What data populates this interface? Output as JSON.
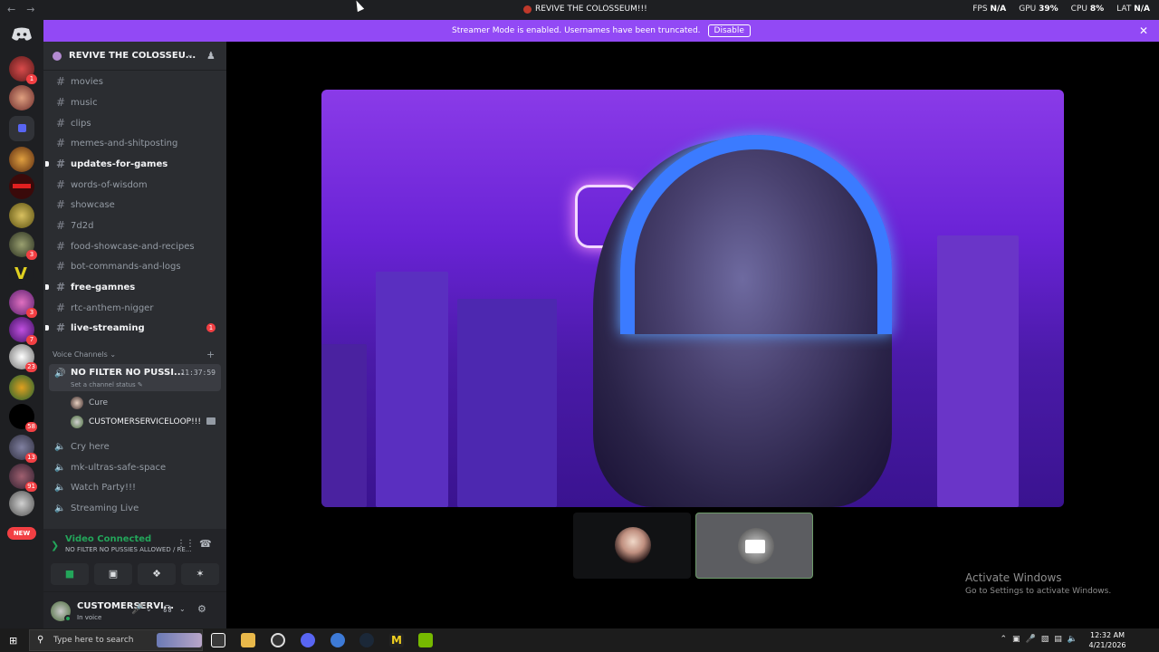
{
  "window": {
    "title": "REVIVE THE COLOSSEUM!!!",
    "stats": [
      {
        "label": "FPS",
        "value": "N/A"
      },
      {
        "label": "GPU",
        "value": "39%"
      },
      {
        "label": "CPU",
        "value": "8%"
      },
      {
        "label": "LAT",
        "value": "N/A"
      }
    ]
  },
  "banner": {
    "text": "Streamer Mode is enabled. Usernames have been truncated.",
    "button": "Disable"
  },
  "rail": {
    "badges": [
      "1",
      "3",
      "3",
      "7",
      "23",
      "58",
      "13",
      "91"
    ],
    "new_label": "NEW"
  },
  "server": {
    "name": "REVIVE THE COLOSSEU..."
  },
  "channels": [
    {
      "name": "movies",
      "unread": false
    },
    {
      "name": "music",
      "unread": false
    },
    {
      "name": "clips",
      "unread": false
    },
    {
      "name": "memes-and-shitposting",
      "unread": false
    },
    {
      "name": "updates-for-games",
      "unread": true
    },
    {
      "name": "words-of-wisdom",
      "unread": false
    },
    {
      "name": "showcase",
      "unread": false
    },
    {
      "name": "7d2d",
      "unread": false
    },
    {
      "name": "food-showcase-and-recipes",
      "unread": false
    },
    {
      "name": "bot-commands-and-logs",
      "unread": false
    },
    {
      "name": "free-gamnes",
      "unread": true
    },
    {
      "name": "rtc-anthem-nigger",
      "unread": false
    },
    {
      "name": "live-streaming",
      "unread": true,
      "mentions": "1"
    }
  ],
  "voice": {
    "category": "Voice Channels",
    "active_channel": {
      "name": "NO FILTER NO PUSSI...",
      "timer": "11:37:59",
      "status": "Set a channel status"
    },
    "users": [
      "Cure",
      "CUSTOMERSERVICELOOP!!!"
    ],
    "other_channels": [
      "Cry here",
      "mk-ultras-safe-space",
      "Watch Party!!!",
      "Streaming Live"
    ]
  },
  "connection": {
    "title": "Video Connected",
    "subtitle": "NO FILTER NO PUSSIES ALLOWED / RE..."
  },
  "user": {
    "name": "CUSTOMERSERVI...",
    "status": "In voice"
  },
  "activation": {
    "title": "Activate Windows",
    "subtitle": "Go to Settings to activate Windows."
  },
  "taskbar": {
    "search_placeholder": "Type here to search",
    "time": "12:32 AM",
    "date": "4/21/2026"
  },
  "colors": {
    "banner": "#9249f5",
    "connected": "#23a55a",
    "mention": "#f23f43"
  }
}
